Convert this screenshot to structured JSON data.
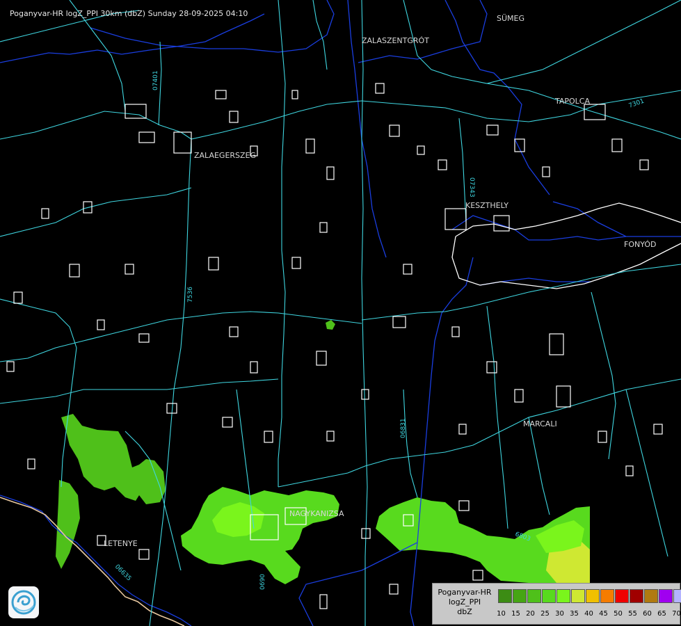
{
  "header": {
    "title": "Poganyvar-HR logZ_PPI 30km (dbZ) Sunday 28-09-2025 04:10"
  },
  "cities": [
    {
      "name": "SÜMEG",
      "id": "city-sumeg"
    },
    {
      "name": "ZALASZENTGRÓT",
      "id": "city-zalaszentgrot"
    },
    {
      "name": "TAPOLCA",
      "id": "city-tapolca"
    },
    {
      "name": "ZALAEGERSZEG",
      "id": "city-zalaegerszeg"
    },
    {
      "name": "KESZTHELY",
      "id": "city-keszthely"
    },
    {
      "name": "FONYÓD",
      "id": "city-fonyod"
    },
    {
      "name": "MARCALI",
      "id": "city-marcali"
    },
    {
      "name": "NAGYKANIZSA",
      "id": "city-nagykanizsa"
    },
    {
      "name": "LETENYE",
      "id": "city-letenye"
    }
  ],
  "legend": {
    "line1": "Poganyvar-HR",
    "line2": "logZ_PPI",
    "line3": "dbZ",
    "scale": [
      {
        "value": "10",
        "color": "#3c8c14"
      },
      {
        "value": "15",
        "color": "#46a514"
      },
      {
        "value": "20",
        "color": "#4fc01a"
      },
      {
        "value": "25",
        "color": "#58da1e"
      },
      {
        "value": "30",
        "color": "#7af51c"
      },
      {
        "value": "35",
        "color": "#cfe832"
      },
      {
        "value": "40",
        "color": "#f0c000"
      },
      {
        "value": "45",
        "color": "#f57c00"
      },
      {
        "value": "50",
        "color": "#f00000"
      },
      {
        "value": "55",
        "color": "#a00000"
      },
      {
        "value": "60",
        "color": "#b07a10"
      },
      {
        "value": "65",
        "color": "#a000f0"
      },
      {
        "value": "70",
        "color": "#b4b4ff"
      }
    ]
  },
  "colors": {
    "road": "#3fd6e0",
    "river": "#1a3ee0",
    "border": "#e8c8a0",
    "settlement": "#ffffff"
  }
}
